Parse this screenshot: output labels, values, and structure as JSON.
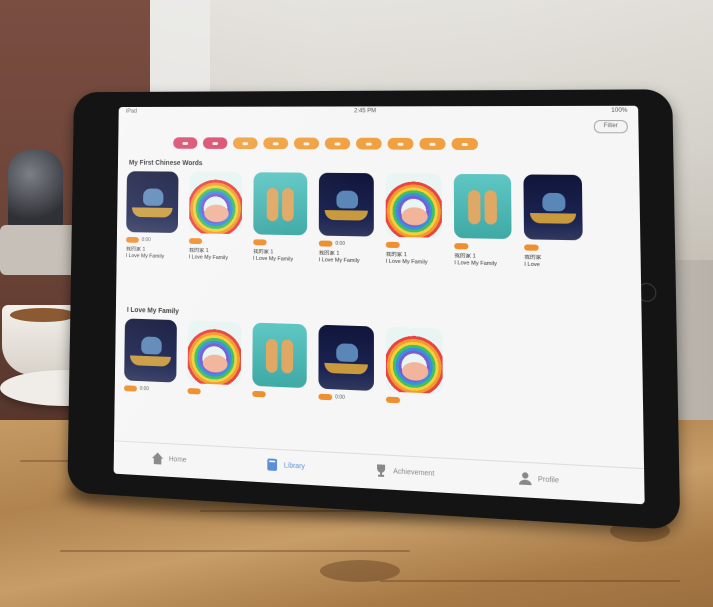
{
  "status_bar": {
    "left": "iPad",
    "center": "2:45 PM",
    "right": "100%"
  },
  "filter_button": {
    "label": "Filter"
  },
  "chips": [
    {
      "selected": true
    },
    {
      "selected": true
    },
    {
      "selected": false
    },
    {
      "selected": false
    },
    {
      "selected": false
    },
    {
      "selected": false
    },
    {
      "selected": false
    },
    {
      "selected": false
    },
    {
      "selected": false
    },
    {
      "selected": false
    }
  ],
  "sections": [
    {
      "title": "My First Chinese Words",
      "cards": [
        {
          "cover": "night",
          "meta": "0:00",
          "title_cn": "我的家 1",
          "title_en": "I Love My Family"
        },
        {
          "cover": "rainbow",
          "meta": "",
          "title_cn": "我的家 1",
          "title_en": "I Love My Family"
        },
        {
          "cover": "teal",
          "meta": "",
          "title_cn": "我的家 1",
          "title_en": "I Love My Family"
        },
        {
          "cover": "night",
          "meta": "0:00",
          "title_cn": "我的家 1",
          "title_en": "I Love My Family"
        },
        {
          "cover": "rainbow",
          "meta": "",
          "title_cn": "我的家 1",
          "title_en": "I Love My Family"
        },
        {
          "cover": "teal",
          "meta": "",
          "title_cn": "我的家 1",
          "title_en": "I Love My Family"
        },
        {
          "cover": "night",
          "meta": "",
          "title_cn": "我的家",
          "title_en": "I Love"
        }
      ]
    },
    {
      "title": "I Love My Family",
      "cards": [
        {
          "cover": "night",
          "meta": "0:00",
          "title_cn": "",
          "title_en": ""
        },
        {
          "cover": "rainbow",
          "meta": "",
          "title_cn": "",
          "title_en": ""
        },
        {
          "cover": "teal",
          "meta": "",
          "title_cn": "",
          "title_en": ""
        },
        {
          "cover": "night",
          "meta": "0:00",
          "title_cn": "",
          "title_en": ""
        },
        {
          "cover": "rainbow",
          "meta": "",
          "title_cn": "",
          "title_en": ""
        }
      ]
    }
  ],
  "tabs": [
    {
      "label": "Home",
      "icon": "home-icon"
    },
    {
      "label": "Library",
      "icon": "book-icon"
    },
    {
      "label": "Achievement",
      "icon": "trophy-icon"
    },
    {
      "label": "Profile",
      "icon": "person-icon"
    }
  ],
  "colors": {
    "chip_active": "#d8486a",
    "chip": "#f0a040",
    "tab_active": "#5b8fd6"
  }
}
